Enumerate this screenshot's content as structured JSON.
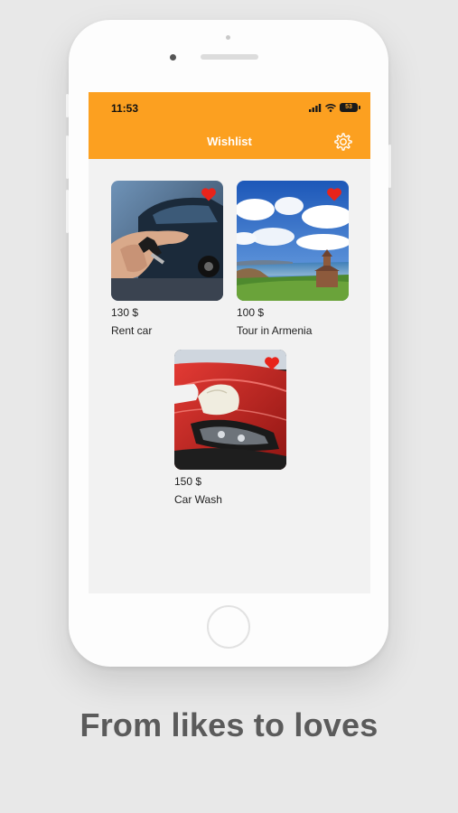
{
  "status_bar": {
    "time": "11:53",
    "battery": "53"
  },
  "header": {
    "title": "Wishlist",
    "settings_icon": "gear-icon"
  },
  "items": [
    {
      "price": "130 $",
      "title": "Rent car",
      "favorited": true
    },
    {
      "price": "100 $",
      "title": "Tour in Armenia",
      "favorited": true
    },
    {
      "price": "150 $",
      "title": "Car Wash",
      "favorited": true
    }
  ],
  "tagline": "From likes to loves",
  "colors": {
    "accent": "#fca020",
    "heart": "#e8241b",
    "screen_bg": "#f2f2f2",
    "tagline": "#5b5b5b"
  }
}
